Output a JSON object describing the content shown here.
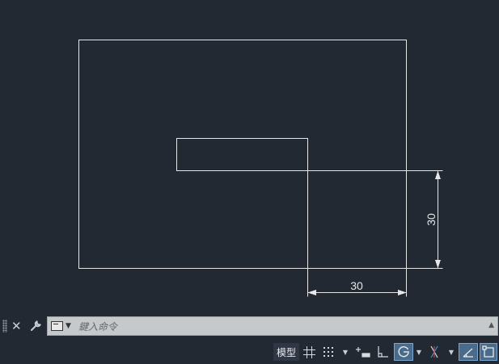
{
  "drawing": {
    "dim_vertical": "30",
    "dim_horizontal": "30",
    "line_color": "#ffffff",
    "background": "#222933"
  },
  "command_line": {
    "placeholder": "鍵入命令"
  },
  "status_bar": {
    "model_label": "模型",
    "icons": [
      "grid-icon",
      "snap-icon",
      "infer-constraints-icon",
      "ortho-icon",
      "polar-tracking-icon",
      "isodraft-icon",
      "dynamic-ucs-icon",
      "selection-cycling-icon"
    ],
    "active_color": "#4a6b8a"
  }
}
